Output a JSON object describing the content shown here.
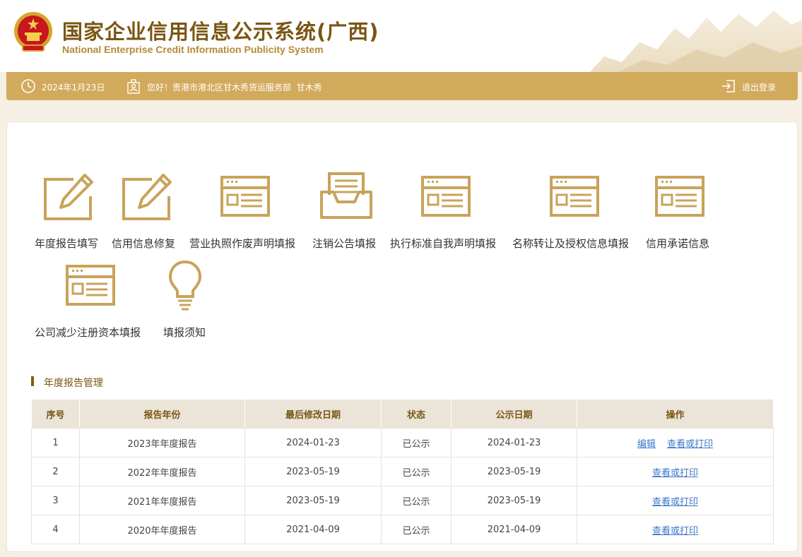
{
  "header": {
    "title_cn": "国家企业信用信息公示系统(广西)",
    "title_en": "National Enterprise Credit Information Publicity System"
  },
  "topbar": {
    "date": "2024年1月23日",
    "greeting": "您好！贵港市港北区甘木秀货运服务部  甘木秀",
    "logout": "退出登录"
  },
  "tiles": [
    {
      "label": "年度报告填写",
      "icon": "edit-icon"
    },
    {
      "label": "信用信息修复",
      "icon": "edit-icon"
    },
    {
      "label": "营业执照作废声明填报",
      "icon": "form-icon"
    },
    {
      "label": "注销公告填报",
      "icon": "inbox-icon"
    },
    {
      "label": "执行标准自我声明填报",
      "icon": "form-icon"
    },
    {
      "label": "名称转让及授权信息填报",
      "icon": "form-icon"
    },
    {
      "label": "信用承诺信息",
      "icon": "form-icon"
    },
    {
      "label": "公司减少注册资本填报",
      "icon": "form-icon"
    },
    {
      "label": "填报须知",
      "icon": "lightbulb-icon"
    }
  ],
  "section": {
    "title": "年度报告管理"
  },
  "table": {
    "headers": [
      "序号",
      "报告年份",
      "最后修改日期",
      "状态",
      "公示日期",
      "操作"
    ],
    "rows": [
      {
        "no": "1",
        "year": "2023年年度报告",
        "modified": "2024-01-23",
        "status": "已公示",
        "published": "2024-01-23",
        "edit": "编辑",
        "view": "查看或打印"
      },
      {
        "no": "2",
        "year": "2022年年度报告",
        "modified": "2023-05-19",
        "status": "已公示",
        "published": "2023-05-19",
        "view": "查看或打印"
      },
      {
        "no": "3",
        "year": "2021年年度报告",
        "modified": "2023-05-19",
        "status": "已公示",
        "published": "2023-05-19",
        "view": "查看或打印"
      },
      {
        "no": "4",
        "year": "2020年年度报告",
        "modified": "2021-04-09",
        "status": "已公示",
        "published": "2021-04-09",
        "view": "查看或打印"
      }
    ]
  },
  "colors": {
    "accent": "#d2aa5c",
    "title": "#7a5613",
    "link": "#3c78c8",
    "icon": "#c9a35a"
  }
}
